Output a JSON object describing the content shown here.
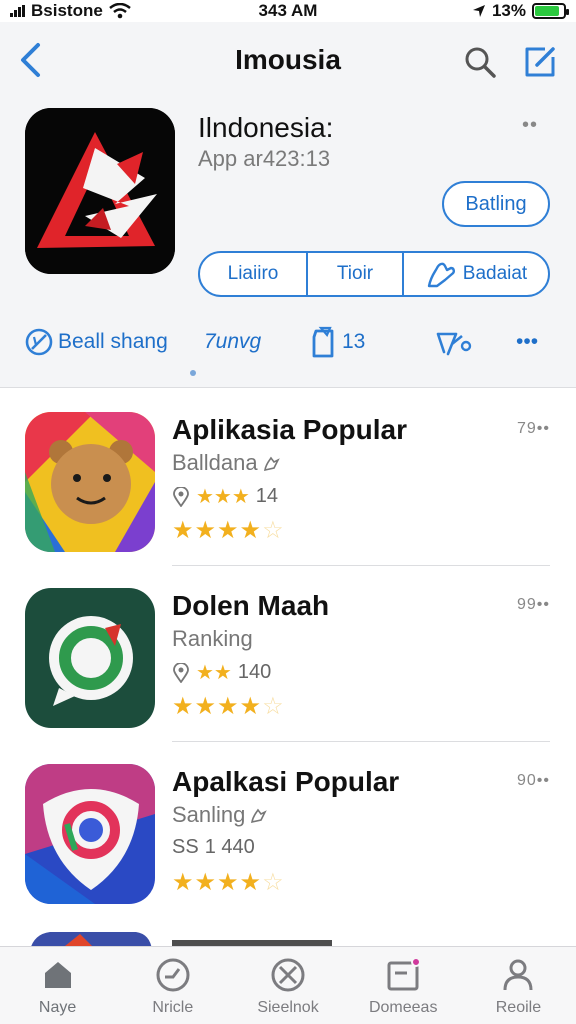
{
  "status_bar": {
    "carrier": "Bsistone",
    "time": "343 AM",
    "battery": "13%",
    "battery_level": 0.85
  },
  "nav": {
    "title": "Imousia",
    "back_icon": "chevron-left-icon",
    "search_icon": "search-icon",
    "compose_icon": "compose-icon"
  },
  "app": {
    "name": "Ilndonesia:",
    "subtitle": "App ar423:13",
    "more": "••",
    "primary_button": "Batling",
    "segments": [
      "Liaiiro",
      "Tioir",
      "Badaiat"
    ]
  },
  "actions": [
    {
      "icon": "badge-icon",
      "label": "Beall shang"
    },
    {
      "icon": "",
      "label": "7unvg"
    },
    {
      "icon": "clipboard-icon",
      "label": "13"
    },
    {
      "icon": "chart-icon",
      "label": ""
    },
    {
      "icon": "ellipsis-icon",
      "label": "•••"
    }
  ],
  "apps": [
    {
      "title": "Aplikasia Popular",
      "category": "Balldana",
      "meta": "14",
      "meta_stars": 3,
      "rating": 4.5,
      "right": "79••"
    },
    {
      "title": "Dolen Maah",
      "category": "Ranking",
      "meta": "140",
      "meta_stars": 2,
      "rating": 4.5,
      "right": "99••"
    },
    {
      "title": "Apalkasi Popular",
      "category": "Sanling",
      "meta": "1 440",
      "meta_prefix": "SS",
      "meta_stars": 0,
      "rating": 4.5,
      "right": "90••"
    }
  ],
  "tabs": [
    {
      "label": "Naye",
      "icon": "home-icon",
      "active": true
    },
    {
      "label": "Nricle",
      "icon": "clock-icon",
      "active": false
    },
    {
      "label": "Sieelnok",
      "icon": "close-circle-icon",
      "active": false
    },
    {
      "label": "Domeeas",
      "icon": "inbox-icon",
      "active": false,
      "badge": true
    },
    {
      "label": "Reoile",
      "icon": "person-icon",
      "active": false
    }
  ],
  "colors": {
    "accent": "#2f7fd6",
    "star": "#f2b01e",
    "badge": "#d0399c",
    "battery": "#2bc93f"
  }
}
